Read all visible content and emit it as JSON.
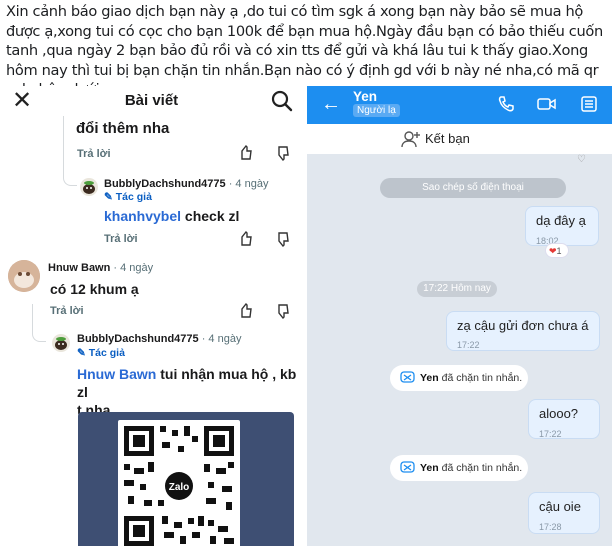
{
  "post": {
    "text": "Xin cảnh báo giao dịch bạn này ạ ,do tui có tìm sgk á xong bạn này bảo sẽ mua hộ được ạ,xong tui có cọc cho bạn 100k để bạn mua hộ.Ngày đầu bạn có bảo thiếu cuốn tanh ,qua ngày 2 bạn bảo đủ rồi và có xin tts để gửi và khá lâu tui k thấy giao.Xong hôm nay thì tui bị bạn chặn tin nhắn.Bạn nào có ý định gd với b này né nha,có mã qr zalo bên dưới ạ"
  },
  "reddit": {
    "title": "Bài viết",
    "reply_label": "Trả lời",
    "op_badge": "Tác giả",
    "comments": [
      {
        "text": "đổi thêm nha"
      },
      {
        "user": "BubblyDachshund4775",
        "age": "· 4 ngày",
        "mention": "khanhvybel",
        "text": " check zl"
      },
      {
        "user": "Hnuw Bawn",
        "age": "· 4 ngày",
        "text": "có 12 khum ạ"
      },
      {
        "user": "BubblyDachshund4775",
        "age": "· 4 ngày",
        "mention": "Hnuw Bawn",
        "text": " tui nhận mua hộ , kb zl",
        "text2": "t nha"
      }
    ]
  },
  "zalo": {
    "contact_name": "Yen",
    "contact_tag": "Người lạ",
    "add_friend": "Kết bạn",
    "copy_phone": "Sao chép số điện thoại",
    "date_sep": "17:22 Hôm nay",
    "blocked_name": "Yen",
    "blocked_text": " đã chặn tin nhắn.",
    "reaction_count": "1",
    "messages": [
      {
        "text": "dạ đây ạ",
        "time": "18:02"
      },
      {
        "text": "zạ cậu gửi đơn chưa á",
        "time": "17:22"
      },
      {
        "text": "alooo?",
        "time": "17:22"
      },
      {
        "text": "cậu oie",
        "time": "17:28"
      }
    ]
  },
  "colors": {
    "zalo_blue": "#1d8ef0",
    "reddit_link": "#2a6ad4",
    "bubble": "#e6f1fe"
  }
}
